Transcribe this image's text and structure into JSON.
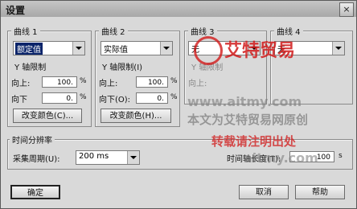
{
  "window": {
    "title": "设置",
    "close_glyph": "×"
  },
  "curves": [
    {
      "title": "曲线 1",
      "combo": "额定值",
      "ylimit": "Y 轴限制",
      "upper_label": "向上:",
      "upper_value": "100.",
      "upper_unit": "%",
      "lower_label": "向下",
      "lower_value": "0.",
      "lower_unit": "%",
      "color_button": "改变颜色(C)..."
    },
    {
      "title": "曲线 2",
      "combo": "实际值",
      "ylimit": "Y 轴限制(I)",
      "upper_label": "向上:",
      "upper_value": "100.",
      "upper_unit": "%",
      "lower_label": "向下(O):",
      "lower_value": "0.",
      "lower_unit": "%",
      "color_button": "改变颜色(H)..."
    },
    {
      "title": "曲线 3",
      "combo": "无",
      "ylimit": "Y 轴限制",
      "upper_label": "向上:"
    },
    {
      "title": "曲线 4",
      "combo": "无"
    }
  ],
  "time": {
    "title": "时间分辨率",
    "period_label": "采集周期(U):",
    "period_value": "200 ms",
    "axis_label": "时间轴长度(T):",
    "axis_value": "100",
    "axis_unit": "s"
  },
  "buttons": {
    "ok": "确定",
    "cancel": "取消",
    "help": "帮助"
  },
  "watermark": {
    "brand": "艾特贸易",
    "url1": "www.aitmy.com",
    "original": "本文为艾特贸易网原创",
    "reprint": "转载请注明出处",
    "url2": "aitmy.com"
  },
  "colors": {
    "accent_red": "#d11a1a",
    "selected_bg": "#0a246a"
  }
}
